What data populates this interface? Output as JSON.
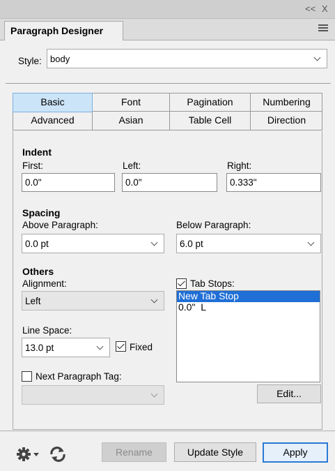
{
  "window": {
    "collapse_glyph": "<<",
    "close_glyph": "X"
  },
  "panel": {
    "title": "Paragraph Designer",
    "menu_icon": "hamburger-menu-icon"
  },
  "style": {
    "label": "Style:",
    "value": "body"
  },
  "tabs": {
    "row1": [
      "Basic",
      "Font",
      "Pagination",
      "Numbering"
    ],
    "row2": [
      "Advanced",
      "Asian",
      "Table Cell",
      "Direction"
    ],
    "active": "Basic"
  },
  "indent": {
    "heading": "Indent",
    "first_label": "First:",
    "first_value": "0.0\"",
    "left_label": "Left:",
    "left_value": "0.0\"",
    "right_label": "Right:",
    "right_value": "0.333\""
  },
  "spacing": {
    "heading": "Spacing",
    "above_label": "Above Paragraph:",
    "above_value": "0.0 pt",
    "below_label": "Below Paragraph:",
    "below_value": "6.0 pt"
  },
  "others": {
    "heading": "Others",
    "alignment_label": "Alignment:",
    "alignment_value": "Left",
    "line_space_label": "Line Space:",
    "line_space_value": "13.0 pt",
    "fixed_label": "Fixed",
    "fixed_checked": true,
    "next_tag_label": "Next Paragraph Tag:",
    "next_tag_checked": false,
    "next_tag_value": ""
  },
  "tab_stops": {
    "label": "Tab Stops:",
    "checked": true,
    "items": [
      "New Tab Stop",
      "0.0\"  L"
    ],
    "selected_index": 0,
    "edit_label": "Edit..."
  },
  "footer": {
    "gear_icon": "gear-icon",
    "refresh_icon": "refresh-icon",
    "rename_label": "Rename",
    "update_label": "Update Style",
    "apply_label": "Apply"
  },
  "colors": {
    "active_tab": "#cce4f7",
    "selection": "#1f6fd6",
    "apply_border": "#2a7ad6"
  }
}
